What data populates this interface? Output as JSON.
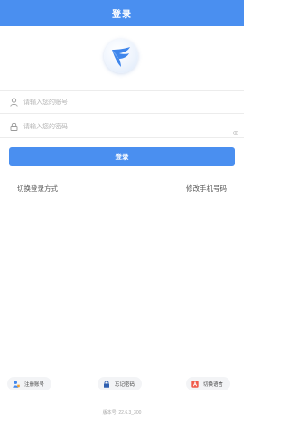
{
  "header": {
    "title": "登录"
  },
  "colors": {
    "accent": "#4a8ff0"
  },
  "form": {
    "account_placeholder": "请输入您的账号",
    "password_placeholder": "请输入您的密码",
    "account_icon": "user-icon",
    "password_icon": "lock-icon",
    "eye_icon": "eye-icon",
    "login_label": "登录"
  },
  "links": {
    "switch_login": "切换登录方式",
    "change_phone": "修改手机号码"
  },
  "bottom_actions": [
    {
      "label": "注册账号",
      "icon": "register-user-icon"
    },
    {
      "label": "忘记密码",
      "icon": "lock-icon"
    },
    {
      "label": "切换语言",
      "icon": "language-icon"
    }
  ],
  "version": "版本号: 22.6.3_300"
}
